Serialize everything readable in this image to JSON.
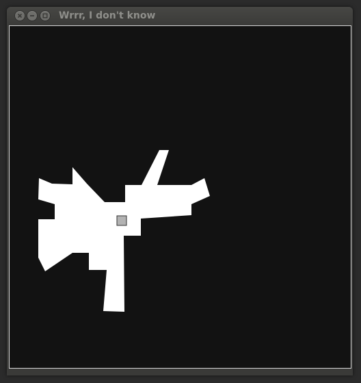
{
  "window": {
    "title": "Wrrr, I don't know"
  },
  "titlebar_buttons": {
    "close_icon": "close-icon",
    "minimize_icon": "minimize-icon",
    "maximize_icon": "maximize-icon"
  },
  "canvas": {
    "background_color": "#121212",
    "shape_color": "#ffffff",
    "marker_color": "#b3b3b3",
    "marker_border_color": "#333333"
  }
}
